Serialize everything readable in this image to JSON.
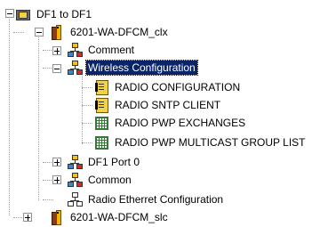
{
  "tree": {
    "root": {
      "label": "DF1 to DF1",
      "expanded": true,
      "icon": "network-folder-icon"
    },
    "items": [
      {
        "label": "6201-WA-DFCM_clx",
        "icon": "controller-icon",
        "expanded": true
      },
      {
        "label": "Comment",
        "icon": "network-nodes-icon",
        "expanded": false
      },
      {
        "label": "Wireless Configuration",
        "icon": "network-nodes-icon",
        "expanded": true,
        "selected": true
      },
      {
        "label": "RADIO CONFIGURATION",
        "icon": "config-document-icon"
      },
      {
        "label": "RADIO SNTP CLIENT",
        "icon": "config-document-icon"
      },
      {
        "label": "RADIO PWP EXCHANGES",
        "icon": "grid-table-icon"
      },
      {
        "label": "RADIO PWP MULTICAST GROUP LIST",
        "icon": "grid-table-icon"
      },
      {
        "label": "DF1 Port 0",
        "icon": "network-nodes-icon",
        "expanded": false
      },
      {
        "label": "Common",
        "icon": "network-nodes-icon",
        "expanded": false
      },
      {
        "label": "Radio Etherret Configuration",
        "icon": "ethernet-icon"
      },
      {
        "label": "6201-WA-DFCM_slc",
        "icon": "controller-icon",
        "expanded": false
      }
    ]
  },
  "colors": {
    "selection": "#0a246a",
    "guide": "#a0a0a0"
  }
}
